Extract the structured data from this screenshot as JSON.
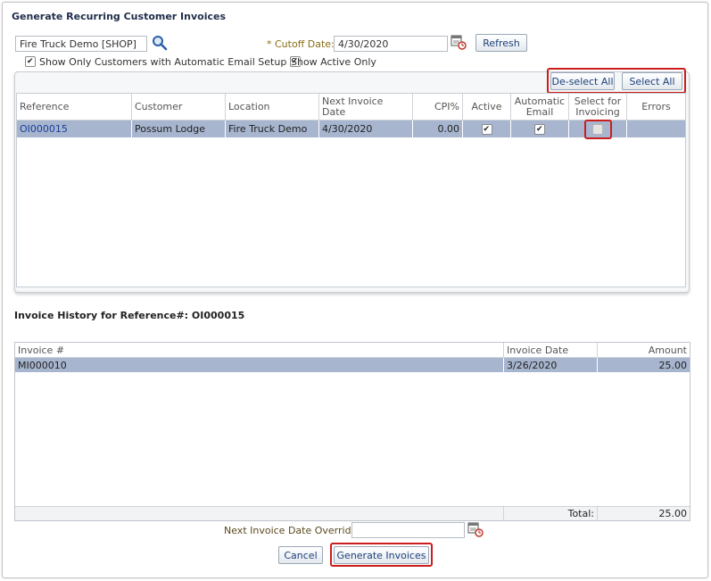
{
  "dialog": {
    "title": "Generate Recurring Customer Invoices"
  },
  "filters": {
    "customer_value": "Fire Truck Demo [SHOP]",
    "cutoff_label": "Cutoff Date:",
    "cutoff_required_mark": "*",
    "cutoff_value": "4/30/2020",
    "refresh_label": "Refresh",
    "email_setup_label": "Show Only Customers with Automatic Email Setup",
    "email_setup_checked": true,
    "active_only_label": "Show Active Only",
    "active_only_checked": true
  },
  "toolbar": {
    "deselect_all_label": "De-select All",
    "select_all_label": "Select All"
  },
  "grid": {
    "columns": [
      "Reference",
      "Customer",
      "Location",
      "Next Invoice Date",
      "CPI%",
      "Active",
      "Automatic Email",
      "Select for Invoicing",
      "Errors"
    ],
    "column_parts": {
      "automatic_email": [
        "Automatic",
        "Email"
      ],
      "select_for_invoicing": [
        "Select for",
        "Invoicing"
      ]
    },
    "rows": [
      {
        "reference": "OI000015",
        "customer": "Possum Lodge",
        "location": "Fire Truck Demo",
        "next_invoice_date": "4/30/2020",
        "cpi": "0.00",
        "active": true,
        "automatic_email": true,
        "select_for_invoicing": false,
        "errors": ""
      }
    ]
  },
  "history": {
    "title": "Invoice History for Reference#: OI000015",
    "columns": [
      "Invoice #",
      "Invoice Date",
      "Amount"
    ],
    "rows": [
      {
        "invoice": "MI000010",
        "date": "3/26/2020",
        "amount": "25.00"
      }
    ],
    "total_label": "Total:",
    "total_value": "25.00"
  },
  "footer": {
    "override_label": "Next Invoice Date Override:",
    "override_value": "",
    "cancel_label": "Cancel",
    "generate_label": "Generate Invoices"
  },
  "colors": {
    "selected_row": "#a7b5cf",
    "highlight_outline": "#cc1c1c",
    "link_text": "#1b3f9a"
  },
  "icons": [
    "search-icon",
    "calendar-clock-icon"
  ]
}
